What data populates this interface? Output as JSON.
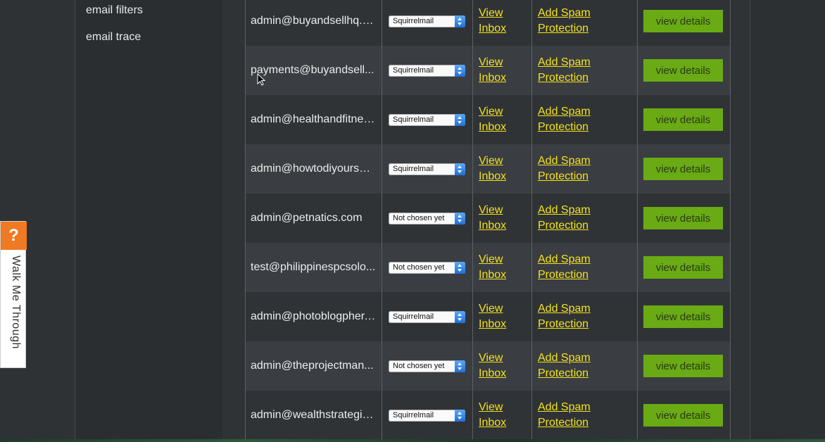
{
  "sidebar": {
    "items": [
      {
        "label": "email filters"
      },
      {
        "label": "email trace"
      }
    ]
  },
  "accounts": [
    {
      "email": "admin@buyandsellhq.c...",
      "client": "Squirrelmail",
      "inbox": [
        "View",
        "Inbox"
      ],
      "spam": [
        "Add Spam",
        "Protection"
      ],
      "details": "view details"
    },
    {
      "email": "payments@buyandsell...",
      "client": "Squirrelmail",
      "inbox": [
        "View",
        "Inbox"
      ],
      "spam": [
        "Add Spam",
        "Protection"
      ],
      "details": "view details"
    },
    {
      "email": "admin@healthandfitnes...",
      "client": "Squirrelmail",
      "inbox": [
        "View",
        "Inbox"
      ],
      "spam": [
        "Add Spam",
        "Protection"
      ],
      "details": "view details"
    },
    {
      "email": "admin@howtodiyoursel...",
      "client": "Squirrelmail",
      "inbox": [
        "View",
        "Inbox"
      ],
      "spam": [
        "Add Spam",
        "Protection"
      ],
      "details": "view details"
    },
    {
      "email": "admin@petnatics.com",
      "client": "Not chosen yet",
      "inbox": [
        "View",
        "Inbox"
      ],
      "spam": [
        "Add Spam",
        "Protection"
      ],
      "details": "view details"
    },
    {
      "email": "test@philippinespcsolo...",
      "client": "Not chosen yet",
      "inbox": [
        "View",
        "Inbox"
      ],
      "spam": [
        "Add Spam",
        "Protection"
      ],
      "details": "view details"
    },
    {
      "email": "admin@photoblogpher....",
      "client": "Squirrelmail",
      "inbox": [
        "View",
        "Inbox"
      ],
      "spam": [
        "Add Spam",
        "Protection"
      ],
      "details": "view details"
    },
    {
      "email": "admin@theprojectman...",
      "client": "Not chosen yet",
      "inbox": [
        "View",
        "Inbox"
      ],
      "spam": [
        "Add Spam",
        "Protection"
      ],
      "details": "view details"
    },
    {
      "email": "admin@wealthstrategie...",
      "client": "Squirrelmail",
      "inbox": [
        "View",
        "Inbox"
      ],
      "spam": [
        "Add Spam",
        "Protection"
      ],
      "details": "view details"
    }
  ],
  "walkthrough": {
    "icon": "question-mark-icon",
    "glyph": "?",
    "label": "Walk Me Through"
  },
  "colors": {
    "accent_button": "#6aaa14",
    "link": "#f2e21c",
    "help_tab": "#f07a22"
  }
}
